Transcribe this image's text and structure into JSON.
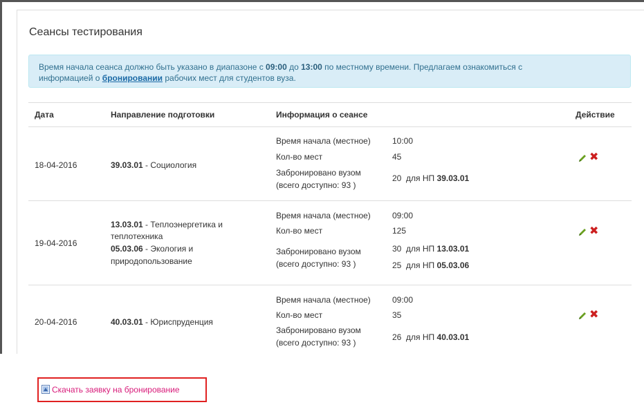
{
  "panel": {
    "title": "Сеансы тестирования"
  },
  "alert": {
    "text1": "Время начала сеанса должно быть указано в диапазоне с ",
    "time_from": "09:00",
    "text2": " до ",
    "time_to": "13:00",
    "text3": " по местному времени. Предлагаем ознакомиться с",
    "text4": "информацией о ",
    "link": "бронировании",
    "text5": " рабочих мест для студентов вуза."
  },
  "table": {
    "headers": {
      "date": "Дата",
      "direction": "Направление подготовки",
      "info": "Информация о сеансе",
      "action": "Действие"
    },
    "labels": {
      "start": "Время начала (местное)",
      "seats": "Кол-во мест",
      "booked": "Забронировано вузом",
      "available_prefix": "(всего доступно: 93 )",
      "for_np": "для НП"
    },
    "rows": [
      {
        "date": "18-04-2016",
        "directions": [
          {
            "code": "39.03.01",
            "name": " - Социология"
          }
        ],
        "start": "10:00",
        "seats": "45",
        "booked": [
          {
            "count": "20",
            "code": "39.03.01"
          }
        ]
      },
      {
        "date": "19-04-2016",
        "directions": [
          {
            "code": "13.03.01",
            "name": " - Теплоэнергетика и",
            "name2": "теплотехника"
          },
          {
            "code": "05.03.06",
            "name": " - Экология и",
            "name2": "природопользование"
          }
        ],
        "start": "09:00",
        "seats": "125",
        "booked": [
          {
            "count": "30",
            "code": "13.03.01"
          },
          {
            "count": "25",
            "code": "05.03.06"
          }
        ]
      },
      {
        "date": "20-04-2016",
        "directions": [
          {
            "code": "40.03.01",
            "name": " - Юриспруденция"
          }
        ],
        "start": "09:00",
        "seats": "35",
        "booked": [
          {
            "count": "26",
            "code": "40.03.01"
          }
        ]
      }
    ]
  },
  "download": {
    "label": "Скачать заявку на бронирование"
  },
  "icons": {
    "edit": "pencil-icon",
    "delete": "close-icon",
    "document": "document-icon"
  },
  "colors": {
    "alert_bg": "#d9edf7",
    "delete": "#cc1f1f",
    "edit": "#6aa020",
    "link_pink": "#d81b7a",
    "highlight_box": "#e02020"
  }
}
